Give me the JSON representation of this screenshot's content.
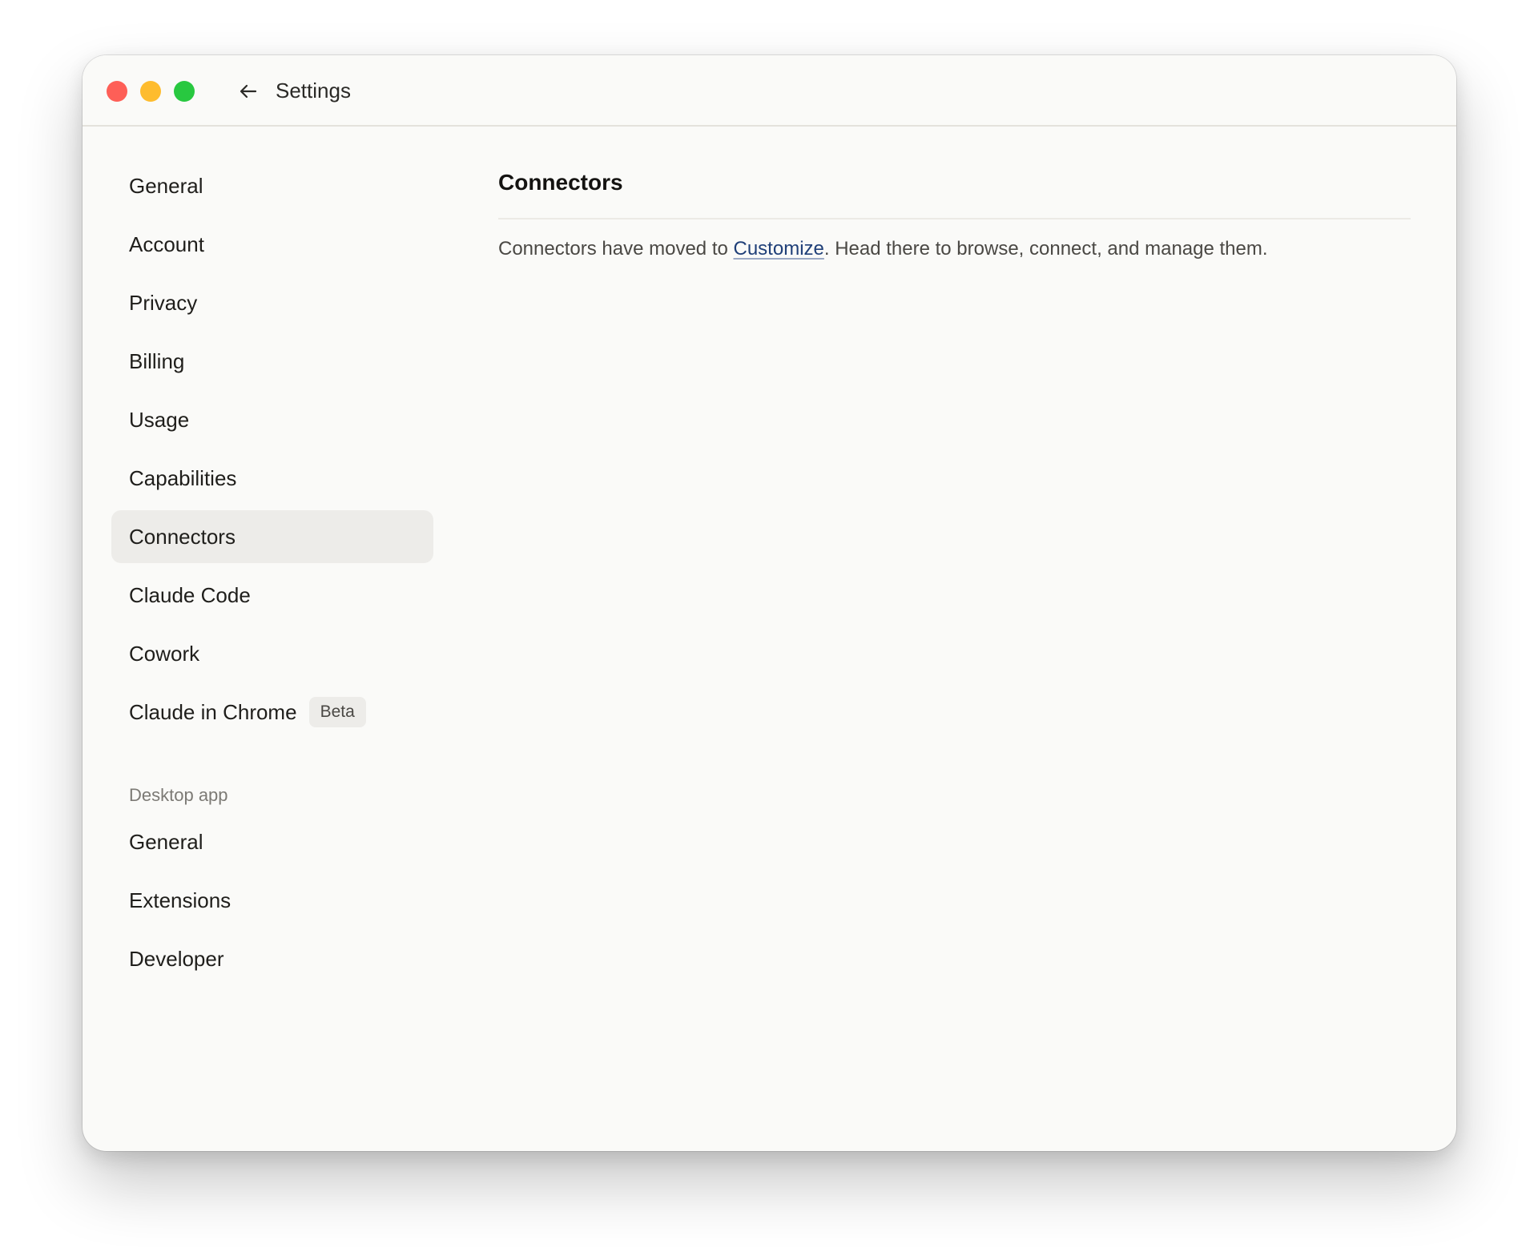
{
  "window": {
    "title": "Settings"
  },
  "sidebar": {
    "items": [
      {
        "label": "General"
      },
      {
        "label": "Account"
      },
      {
        "label": "Privacy"
      },
      {
        "label": "Billing"
      },
      {
        "label": "Usage"
      },
      {
        "label": "Capabilities"
      },
      {
        "label": "Connectors",
        "active": true
      },
      {
        "label": "Claude Code"
      },
      {
        "label": "Cowork"
      },
      {
        "label": "Claude in Chrome",
        "badge": "Beta"
      }
    ],
    "desktop_section_label": "Desktop app",
    "desktop_items": [
      {
        "label": "General"
      },
      {
        "label": "Extensions"
      },
      {
        "label": "Developer"
      }
    ]
  },
  "main": {
    "title": "Connectors",
    "text_before_link": "Connectors have moved to ",
    "link_label": "Customize",
    "text_after_link": ". Head there to browse, connect, and manage them."
  },
  "colors": {
    "window_background": "#fafaf8",
    "active_item_background": "#edece9",
    "link": "#1f3f78",
    "traffic_red": "#fe5f57",
    "traffic_yellow": "#febc2e",
    "traffic_green": "#28c840"
  },
  "icons": {
    "back": "arrow-left-icon"
  }
}
